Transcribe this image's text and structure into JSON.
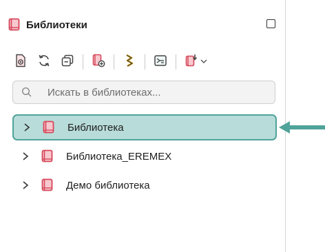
{
  "panel": {
    "title": "Библиотеки",
    "title_icon": "library-book-icon",
    "maximize_icon": "maximize-icon"
  },
  "toolbar": {
    "buttons": [
      {
        "icon": "view-document-icon"
      },
      {
        "icon": "refresh-icon"
      },
      {
        "icon": "collapse-all-icon"
      },
      {
        "icon": "add-library-icon"
      },
      {
        "icon": "component-icon"
      },
      {
        "icon": "symbol-icon"
      },
      {
        "icon": "import-library-icon"
      }
    ]
  },
  "search": {
    "placeholder": "Искать в библиотеках..."
  },
  "tree": {
    "items": [
      {
        "label": "Библиотека",
        "selected": true
      },
      {
        "label": "Библиотека_EREMEX",
        "selected": false
      },
      {
        "label": "Демо библиотека",
        "selected": false
      }
    ]
  },
  "colors": {
    "accent_book": "#d6465a",
    "selection_bg": "#b8dcd9",
    "selection_border": "#4fa39a",
    "arrow": "#4fa39a"
  }
}
